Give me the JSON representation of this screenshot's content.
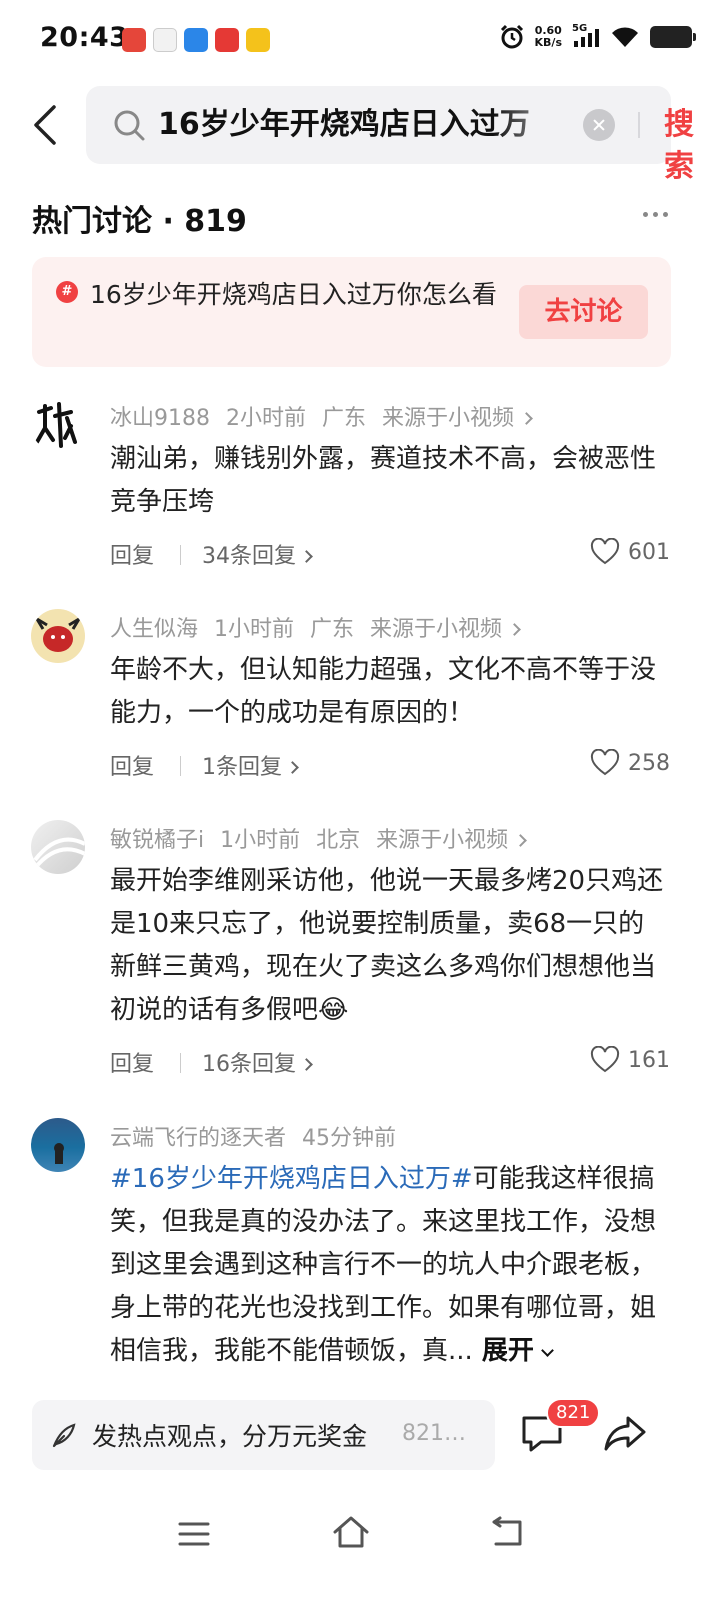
{
  "status_bar": {
    "time": "20:43",
    "net_speed_value": "0.60",
    "net_speed_unit": "KB/s",
    "network": "5G"
  },
  "search": {
    "query": "16岁少年开烧鸡店日入过万",
    "button_label": "搜索"
  },
  "section": {
    "title": "热门讨论 · 819"
  },
  "topic": {
    "icon_label": "#",
    "text": "16岁少年开烧鸡店日入过万你怎么看",
    "button_label": "去讨论"
  },
  "comments": [
    {
      "user": "冰山9188",
      "time": "2小时前",
      "location": "广东",
      "source": "来源于小视频",
      "text": "潮汕弟，赚钱别外露，赛道技术不高，会被恶性竞争压垮",
      "reply_label": "回复",
      "reply_count": "34条回复",
      "likes": "601"
    },
    {
      "user": "人生似海",
      "time": "1小时前",
      "location": "广东",
      "source": "来源于小视频",
      "text": "年龄不大，但认知能力超强，文化不高不等于没能力，一个的成功是有原因的！",
      "reply_label": "回复",
      "reply_count": "1条回复",
      "likes": "258"
    },
    {
      "user": "敏锐橘子i",
      "time": "1小时前",
      "location": "北京",
      "source": "来源于小视频",
      "text": "最开始李维刚采访他，他说一天最多烤20只鸡还是10来只忘了，他说要控制质量，卖68一只的新鲜三黄鸡，现在火了卖这么多鸡你们想想他当初说的话有多假吧😂",
      "reply_label": "回复",
      "reply_count": "16条回复",
      "likes": "161"
    },
    {
      "user": "云端飞行的逐天者",
      "time": "45分钟前",
      "hashtag": "#16岁少年开烧鸡店日入过万#",
      "text": "可能我这样很搞笑，但我是真的没办法了。来这里找工作，没想到这里会遇到这种言行不一的坑人中介跟老板，身上带的花光也没找到工作。如果有哪位哥，姐相信我，我能不能借顿饭，真...",
      "expand_label": "展开"
    }
  ],
  "bottom_bar": {
    "compose_label": "发热点观点，分万元奖金",
    "compose_count": "821…",
    "comment_badge": "821"
  },
  "colors": {
    "accent": "#f04142",
    "hashtag": "#2a6ab8",
    "topic_bg": "#fdf1f0"
  },
  "icons": [
    "back-arrow-icon",
    "search-icon",
    "clear-icon",
    "more-icon",
    "topic-hash-icon",
    "heart-icon",
    "chevron-right-icon",
    "pen-icon",
    "comment-icon",
    "share-icon",
    "menu-icon",
    "home-icon",
    "back-nav-icon"
  ]
}
